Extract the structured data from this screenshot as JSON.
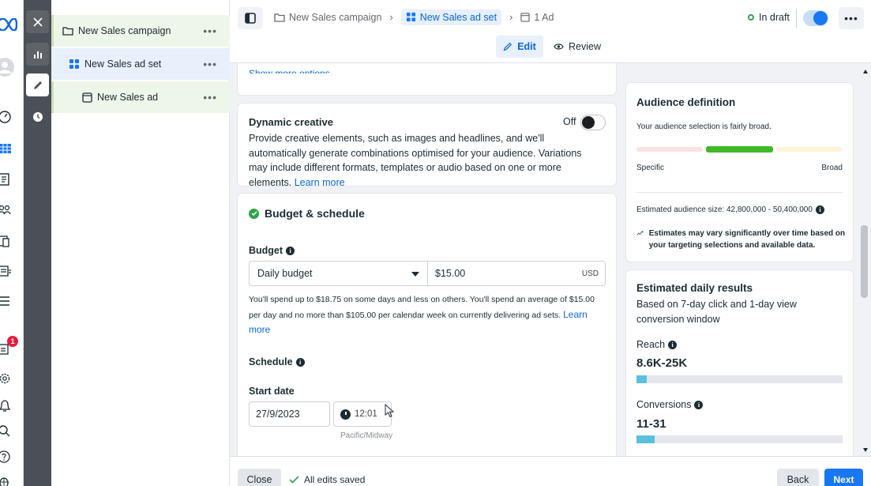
{
  "rail": {
    "notification_count": "1"
  },
  "tree": {
    "campaign_label": "New Sales campaign",
    "adset_label": "New Sales ad set",
    "ad_label": "New Sales ad",
    "more_glyph": "•••"
  },
  "header": {
    "breadcrumbs": [
      {
        "label": "New Sales campaign"
      },
      {
        "label": "New Sales ad set"
      },
      {
        "label": "1 Ad"
      }
    ],
    "status": "In draft",
    "more_glyph": "•••",
    "edit_label": "Edit",
    "review_label": "Review"
  },
  "main": {
    "show_more": "Show more options",
    "dynamic": {
      "title": "Dynamic creative",
      "toggle_label": "Off",
      "description": "Provide creative elements, such as images and headlines, and we'll automatically generate combinations optimised for your audience. Variations may include different formats, templates or audio based on one or more elements.",
      "learn_more": "Learn more"
    },
    "budget": {
      "section_title": "Budget & schedule",
      "budget_label": "Budget",
      "budget_type": "Daily budget",
      "amount": "$15.00",
      "currency": "USD",
      "note": "You'll spend up to $18.75 on some days and less on others. You'll spend an average of $15.00 per day and no more than $105.00 per calendar week on currently delivering ad sets.",
      "learn_more": "Learn more",
      "schedule_label": "Schedule",
      "start_date_label": "Start date",
      "start_date": "27/9/2023",
      "start_time": "12:01",
      "timezone": "Pacific/Midway"
    }
  },
  "audience": {
    "title": "Audience definition",
    "subtitle": "Your audience selection is fairly broad.",
    "specific_label": "Specific",
    "broad_label": "Broad",
    "size": "Estimated audience size: 42,800,000 - 50,400,000",
    "note": "Estimates may vary significantly over time based on your targeting selections and available data."
  },
  "results": {
    "title": "Estimated daily results",
    "subtitle": "Based on 7-day click and 1-day view conversion window",
    "reach_label": "Reach",
    "reach_value": "8.6K-25K",
    "reach_fill": 0.05,
    "conversions_label": "Conversions",
    "conversions_value": "11-31",
    "conversions_fill": 0.09
  },
  "footer": {
    "close_label": "Close",
    "saved_label": "All edits saved",
    "back_label": "Back",
    "next_label": "Next"
  },
  "colors": {
    "accent": "#1877f2",
    "link": "#0a66d8",
    "success": "#31a24c",
    "tool_bg": "#4b4f56"
  }
}
